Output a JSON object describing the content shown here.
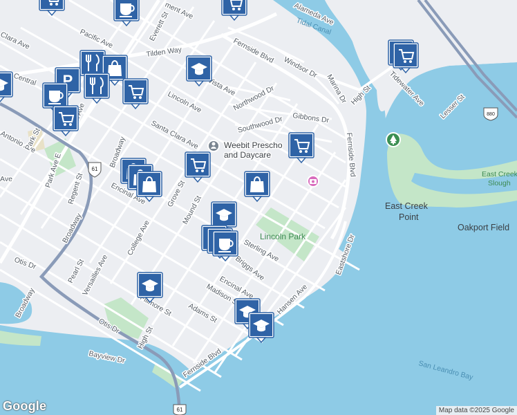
{
  "map": {
    "water_color": "#8ecbe6",
    "land_color": "#eceef2",
    "park_color": "#c4e6c8",
    "marker_color": "#2f63a6",
    "road_labels": [
      {
        "id": "pacific-ave",
        "text": "Pacific Ave"
      },
      {
        "id": "everett-st",
        "text": "Everett St"
      },
      {
        "id": "tilden-way",
        "text": "Tilden Way"
      },
      {
        "id": "fernside-blvd-top",
        "text": "Fernside Blvd"
      },
      {
        "id": "windsor-dr",
        "text": "Windsor Dr"
      },
      {
        "id": "marina-dr",
        "text": "Marina Dr"
      },
      {
        "id": "high-st-top",
        "text": "High St"
      },
      {
        "id": "tidewater-ave",
        "text": "Tidewater Ave"
      },
      {
        "id": "lesser-st",
        "text": "Lesser St"
      },
      {
        "id": "vista-ave",
        "text": "Vista Ave"
      },
      {
        "id": "northwood-dr",
        "text": "Northwood Dr"
      },
      {
        "id": "lincoln-ave",
        "text": "Lincoln Ave"
      },
      {
        "id": "gibbons-dr",
        "text": "Gibbons Dr"
      },
      {
        "id": "southwood-dr",
        "text": "Southwood Dr"
      },
      {
        "id": "santa-clara-ave",
        "text": "Santa Clara Ave"
      },
      {
        "id": "fernside-blvd-right",
        "text": "Fernside Blvd"
      },
      {
        "id": "central-ave",
        "text": "Central"
      },
      {
        "id": "park-ave",
        "text": "Park Ave"
      },
      {
        "id": "broadway-top",
        "text": "Broadway"
      },
      {
        "id": "antonio-ave",
        "text": "Antonio Ave"
      },
      {
        "id": "park-st",
        "text": "Park St"
      },
      {
        "id": "park-ave-lower",
        "text": "Park Ave E"
      },
      {
        "id": "regent-st",
        "text": "Regent St"
      },
      {
        "id": "encinal-ave",
        "text": "Encinal Ave"
      },
      {
        "id": "grove-st",
        "text": "Grove St"
      },
      {
        "id": "mound-st",
        "text": "Mound St"
      },
      {
        "id": "sterling-ave",
        "text": "Sterling Ave"
      },
      {
        "id": "college-ave",
        "text": "College Ave"
      },
      {
        "id": "broadway-mid",
        "text": "Broadway"
      },
      {
        "id": "pearl-st",
        "text": "Pearl St"
      },
      {
        "id": "versailles-ave",
        "text": "Versailles Ave"
      },
      {
        "id": "otis-dr-left",
        "text": "Otis Dr"
      },
      {
        "id": "briggs-ave",
        "text": "Briggs Ave"
      },
      {
        "id": "eastshore-dr",
        "text": "Eastshore Dr"
      },
      {
        "id": "encinal-ave-lower",
        "text": "Encinal Ave"
      },
      {
        "id": "hansen-ave",
        "text": "Hansen Ave"
      },
      {
        "id": "madison-st",
        "text": "Madison St"
      },
      {
        "id": "fillmore-st",
        "text": "Fillmore St"
      },
      {
        "id": "adams-st",
        "text": "Adams St"
      },
      {
        "id": "broadway-low",
        "text": "Broadway"
      },
      {
        "id": "high-st-low",
        "text": "High St"
      },
      {
        "id": "otis-dr-low",
        "text": "Otis Dr"
      },
      {
        "id": "bayview-dr",
        "text": "Bayview Dr"
      },
      {
        "id": "fernside-blvd-low",
        "text": "Fernside Blvd"
      },
      {
        "id": "ave-left",
        "text": "Ave"
      },
      {
        "id": "ment-ave",
        "text": "ment Ave"
      },
      {
        "id": "alameda-ave",
        "text": "Alameda Ave"
      },
      {
        "id": "clara-ave",
        "text": "Clara Ave"
      }
    ],
    "water_labels": [
      {
        "id": "tidal-canal",
        "text": "Tidal Canal"
      },
      {
        "id": "san-leandro-bay",
        "text": "San Leandro Bay"
      }
    ],
    "park_labels": [
      {
        "id": "lincoln-park",
        "text": "Lincoln Park"
      },
      {
        "id": "east-creek-slough",
        "text": "East Creek Slough"
      }
    ],
    "place_labels": [
      {
        "id": "east-creek-point",
        "text": "East Creek Point"
      },
      {
        "id": "oakport-field",
        "text": "Oakport Field"
      }
    ],
    "poi": {
      "name_line1": "Weebit Prescho",
      "name_line2": "and Daycare"
    },
    "highway_shields": [
      "61",
      "61",
      "880"
    ],
    "markers": [
      {
        "id": "marker-cafe-top",
        "type": "cafe",
        "icon": "coffee-cup-icon"
      },
      {
        "id": "marker-shopping-cart-top-right",
        "type": "grocery",
        "icon": "shopping-cart-icon"
      },
      {
        "id": "marker-school-vista",
        "type": "school",
        "icon": "graduation-cap-icon"
      },
      {
        "id": "marker-grocery-fernside",
        "type": "grocery",
        "icon": "shopping-cart-icon"
      },
      {
        "id": "marker-grocery-santa-clara",
        "type": "grocery",
        "icon": "shopping-cart-icon"
      },
      {
        "id": "marker-shopping-bag-lincoln",
        "type": "shopping",
        "icon": "shopping-bag-icon"
      },
      {
        "id": "marker-shopping-bag-grove",
        "type": "shopping",
        "icon": "shopping-bag-icon"
      },
      {
        "id": "marker-school-mound",
        "type": "school",
        "icon": "graduation-cap-icon"
      },
      {
        "id": "marker-cafe-sterling",
        "type": "cafe",
        "icon": "coffee-cup-icon"
      },
      {
        "id": "marker-school-fillmore",
        "type": "school",
        "icon": "graduation-cap-icon"
      },
      {
        "id": "marker-school-encinal-a",
        "type": "school",
        "icon": "graduation-cap-icon"
      },
      {
        "id": "marker-school-encinal-b",
        "type": "school",
        "icon": "graduation-cap-icon"
      },
      {
        "id": "marker-restaurant-park",
        "type": "restaurant",
        "icon": "fork-knife-icon"
      },
      {
        "id": "marker-cafe-park",
        "type": "cafe",
        "icon": "coffee-cup-icon"
      },
      {
        "id": "marker-grocery-park",
        "type": "grocery",
        "icon": "shopping-cart-icon"
      },
      {
        "id": "marker-grocery-central",
        "type": "grocery",
        "icon": "shopping-cart-icon"
      },
      {
        "id": "marker-parking-park",
        "type": "parking",
        "icon": "parking-icon"
      }
    ],
    "attribution": "Map data ©2025 Google",
    "logo_text": "Google"
  }
}
